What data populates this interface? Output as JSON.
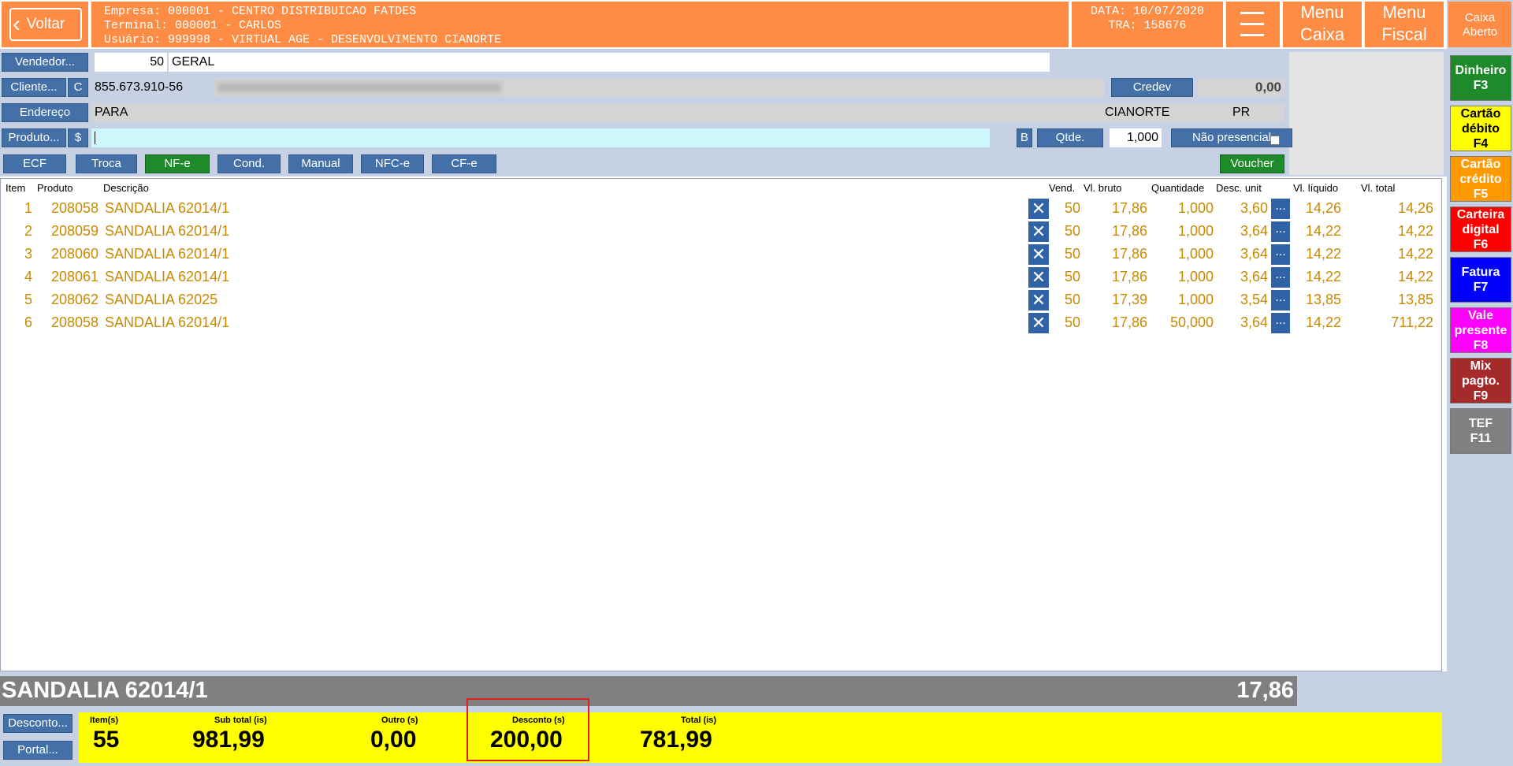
{
  "header": {
    "back_label": "Voltar",
    "company_line": "Empresa: 000001 - CENTRO DISTRIBUICAO FATDES",
    "terminal_line": "Terminal: 000001 - CARLOS",
    "user_line": "Usuário: 999998 - VIRTUAL AGE - DESENVOLVIMENTO CIANORTE",
    "date_line": "DATA: 10/07/2020",
    "tra_line": "TRA: 158676",
    "menu_caixa_line1": "Menu",
    "menu_caixa_line2": "Caixa",
    "menu_fiscal_line1": "Menu",
    "menu_fiscal_line2": "Fiscal",
    "caixa_status_line1": "Caixa",
    "caixa_status_line2": "Aberto"
  },
  "payments": [
    {
      "line1": "Dinheiro",
      "line2": "",
      "line3": "F3",
      "color": "#1e8a2a",
      "text": "#ffffff"
    },
    {
      "line1": "Cartão",
      "line2": "débito",
      "line3": "F4",
      "color": "#ffff00",
      "text": "#000000"
    },
    {
      "line1": "Cartão",
      "line2": "crédito",
      "line3": "F5",
      "color": "#ff9900",
      "text": "#ffffff"
    },
    {
      "line1": "Carteira",
      "line2": "digital",
      "line3": "F6",
      "color": "#ff0000",
      "text": "#ffffff"
    },
    {
      "line1": "Fatura",
      "line2": "",
      "line3": "F7",
      "color": "#0000ff",
      "text": "#ffffff"
    },
    {
      "line1": "Vale",
      "line2": "presente",
      "line3": "F8",
      "color": "#ff00ff",
      "text": "#ffffff"
    },
    {
      "line1": "Mix",
      "line2": "pagto.",
      "line3": "F9",
      "color": "#a52a2a",
      "text": "#ffffff"
    },
    {
      "line1": "TEF",
      "line2": "",
      "line3": "F11",
      "color": "#808080",
      "text": "#ffffff"
    }
  ],
  "form": {
    "vendedor_label": "Vendedor...",
    "vendedor_code": "50",
    "vendedor_name": "GERAL",
    "cliente_label": "Cliente...",
    "cliente_c_label": "C",
    "cliente_doc": "855.673.910-56",
    "credev_label": "Credev",
    "credev_value": "0,00",
    "endereco_label": "Endereço",
    "endereco_value": "PARA",
    "cidade": "CIANORTE",
    "uf": "PR",
    "produto_label": "Produto...",
    "produto_dollar": "$",
    "produto_value": "",
    "b_label": "B",
    "qtde_label": "Qtde.",
    "qtde_value": "1,000",
    "nao_presencial_label": "Não presencial",
    "voucher_label": "Voucher"
  },
  "doc_types": [
    "ECF",
    "Troca",
    "NF-e",
    "Cond.",
    "Manual",
    "NFC-e",
    "CF-e"
  ],
  "table": {
    "headers": {
      "item": "Item",
      "produto": "Produto",
      "descricao": "Descrição",
      "vend": "Vend.",
      "vl_bruto": "Vl. bruto",
      "quantidade": "Quantidade",
      "desc_unit": "Desc. unit",
      "vl_liquido": "Vl. líquido",
      "vl_total": "Vl. total"
    },
    "rows": [
      {
        "item": "1",
        "produto": "208058",
        "descricao": "SANDALIA 62014/1",
        "vend": "50",
        "vl_bruto": "17,86",
        "quantidade": "1,000",
        "desc_unit": "3,60",
        "vl_liquido": "14,26",
        "vl_total": "14,26"
      },
      {
        "item": "2",
        "produto": "208059",
        "descricao": "SANDALIA 62014/1",
        "vend": "50",
        "vl_bruto": "17,86",
        "quantidade": "1,000",
        "desc_unit": "3,64",
        "vl_liquido": "14,22",
        "vl_total": "14,22"
      },
      {
        "item": "3",
        "produto": "208060",
        "descricao": "SANDALIA 62014/1",
        "vend": "50",
        "vl_bruto": "17,86",
        "quantidade": "1,000",
        "desc_unit": "3,64",
        "vl_liquido": "14,22",
        "vl_total": "14,22"
      },
      {
        "item": "4",
        "produto": "208061",
        "descricao": "SANDALIA 62014/1",
        "vend": "50",
        "vl_bruto": "17,86",
        "quantidade": "1,000",
        "desc_unit": "3,64",
        "vl_liquido": "14,22",
        "vl_total": "14,22"
      },
      {
        "item": "5",
        "produto": "208062",
        "descricao": "SANDALIA 62025",
        "vend": "50",
        "vl_bruto": "17,39",
        "quantidade": "1,000",
        "desc_unit": "3,54",
        "vl_liquido": "13,85",
        "vl_total": "13,85"
      },
      {
        "item": "6",
        "produto": "208058",
        "descricao": "SANDALIA 62014/1",
        "vend": "50",
        "vl_bruto": "17,86",
        "quantidade": "50,000",
        "desc_unit": "3,64",
        "vl_liquido": "14,22",
        "vl_total": "711,22"
      }
    ]
  },
  "current_product": {
    "name": "SANDALIA 62014/1",
    "price": "17,86"
  },
  "bottom": {
    "desconto_button": "Desconto...",
    "portal_button": "Portal...",
    "itens_label": "Item(s)",
    "itens_value": "55",
    "subtotal_label": "Sub total (is)",
    "subtotal_value": "981,99",
    "outro_label": "Outro (s)",
    "outro_value": "0,00",
    "desconto_label": "Desconto (s)",
    "desconto_value": "200,00",
    "total_label": "Total (is)",
    "total_value": "781,99"
  },
  "colors": {
    "accent": "#ff8c45",
    "row_text": "#c98a00",
    "highlight": "#ffff00",
    "panel": "#c6d2e3"
  }
}
